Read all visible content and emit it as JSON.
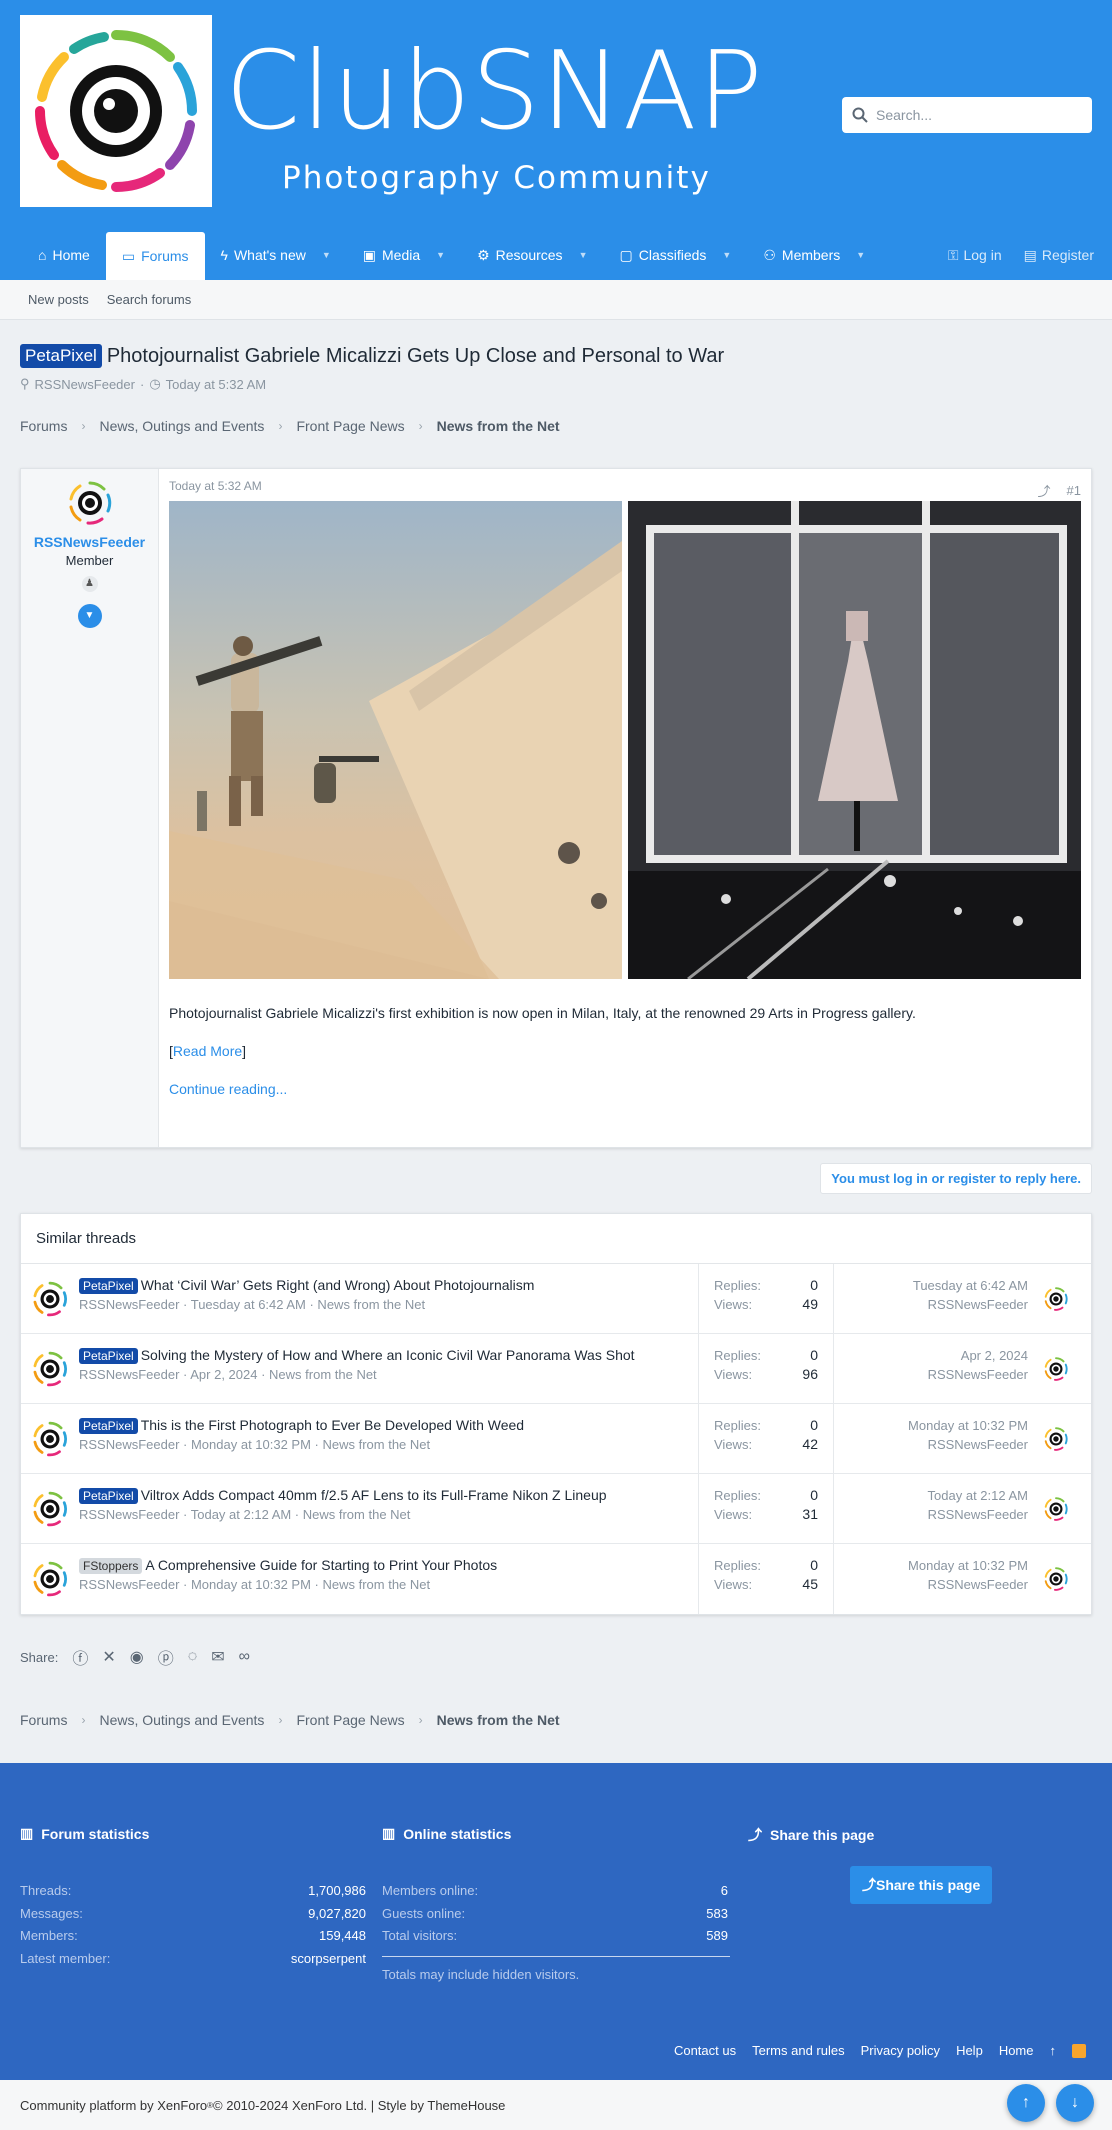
{
  "header": {
    "logo_title": "ClubSNAP",
    "logo_subtitle": "Photography Community",
    "search_placeholder": "Search..."
  },
  "nav": {
    "items": [
      {
        "label": "Home",
        "icon": "home-icon"
      },
      {
        "label": "Forums",
        "icon": "comments-icon"
      },
      {
        "label": "What's new",
        "icon": "bolt-icon"
      },
      {
        "label": "Media",
        "icon": "image-icon"
      },
      {
        "label": "Resources",
        "icon": "cogs-icon"
      },
      {
        "label": "Classifieds",
        "icon": "folder-icon"
      },
      {
        "label": "Members",
        "icon": "users-icon"
      }
    ],
    "login": "Log in",
    "register": "Register"
  },
  "subnav": {
    "new_posts": "New posts",
    "search_forums": "Search forums"
  },
  "thread": {
    "prefix": "PetaPixel",
    "title": "Photojournalist Gabriele Micalizzi Gets Up Close and Personal to War",
    "author": "RSSNewsFeeder",
    "date": "Today at 5:32 AM"
  },
  "breadcrumb": [
    "Forums",
    "News, Outings and Events",
    "Front Page News",
    "News from the Net"
  ],
  "post": {
    "username": "RSSNewsFeeder",
    "user_title": "Member",
    "date": "Today at 5:32 AM",
    "number": "#1",
    "body": "Photojournalist Gabriele Micalizzi's first exhibition is now open in Milan, Italy, at the renowned 29 Arts in Progress gallery.",
    "read_more_open": "[",
    "read_more": "Read More",
    "read_more_close": "]",
    "continue": "Continue reading..."
  },
  "reply_note": "You must log in or register to reply here.",
  "similar": {
    "heading": "Similar threads",
    "replies_label": "Replies:",
    "views_label": "Views:",
    "rows": [
      {
        "prefix": "PetaPixel",
        "gray": false,
        "title": "What ‘Civil War’ Gets Right (and Wrong) About Photojournalism",
        "meta": "RSSNewsFeeder · Tuesday at 6:42 AM · News from the Net",
        "replies": "0",
        "views": "49",
        "last_date": "Tuesday at 6:42 AM",
        "last_user": "RSSNewsFeeder"
      },
      {
        "prefix": "PetaPixel",
        "gray": false,
        "title": "Solving the Mystery of How and Where an Iconic Civil War Panorama Was Shot",
        "meta": "RSSNewsFeeder · Apr 2, 2024 · News from the Net",
        "replies": "0",
        "views": "96",
        "last_date": "Apr 2, 2024",
        "last_user": "RSSNewsFeeder"
      },
      {
        "prefix": "PetaPixel",
        "gray": false,
        "title": "This is the First Photograph to Ever Be Developed With Weed",
        "meta": "RSSNewsFeeder · Monday at 10:32 PM · News from the Net",
        "replies": "0",
        "views": "42",
        "last_date": "Monday at 10:32 PM",
        "last_user": "RSSNewsFeeder"
      },
      {
        "prefix": "PetaPixel",
        "gray": false,
        "title": "Viltrox Adds Compact 40mm f/2.5 AF Lens to its Full-Frame Nikon Z Lineup",
        "meta": "RSSNewsFeeder · Today at 2:12 AM · News from the Net",
        "replies": "0",
        "views": "31",
        "last_date": "Today at 2:12 AM",
        "last_user": "RSSNewsFeeder"
      },
      {
        "prefix": "FStoppers",
        "gray": true,
        "title": "A Comprehensive Guide for Starting to Print Your Photos",
        "meta": "RSSNewsFeeder · Monday at 10:32 PM · News from the Net",
        "replies": "0",
        "views": "45",
        "last_date": "Monday at 10:32 PM",
        "last_user": "RSSNewsFeeder"
      }
    ]
  },
  "share": {
    "label": "Share:"
  },
  "footer": {
    "forum_stats_title": "Forum statistics",
    "forum_stats": [
      {
        "label": "Threads:",
        "value": "1,700,986"
      },
      {
        "label": "Messages:",
        "value": "9,027,820"
      },
      {
        "label": "Members:",
        "value": "159,448"
      },
      {
        "label": "Latest member:",
        "value": "scorpserpent"
      }
    ],
    "online_title": "Online statistics",
    "online_stats": [
      {
        "label": "Members online:",
        "value": "6"
      },
      {
        "label": "Guests online:",
        "value": "583"
      },
      {
        "label": "Total visitors:",
        "value": "589"
      }
    ],
    "online_note": "Totals may include hidden visitors.",
    "share_title": "Share this page",
    "share_button": "Share this page",
    "links": [
      "Contact us",
      "Terms and rules",
      "Privacy policy",
      "Help",
      "Home"
    ],
    "copyright_pre": "Community platform by XenForo",
    "copyright_reg": "®",
    "copyright_post": " © 2010-2024 XenForo Ltd. | Style by ThemeHouse"
  }
}
